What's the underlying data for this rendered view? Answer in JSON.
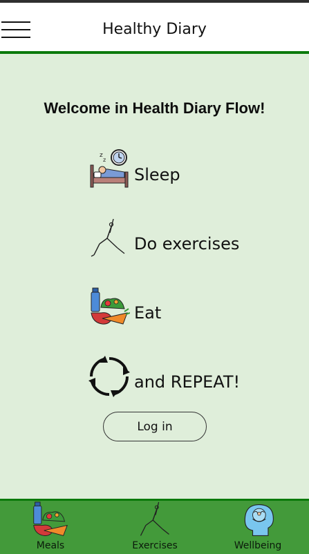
{
  "header": {
    "title": "Healthy Diary",
    "menu_icon": "hamburger-menu-icon"
  },
  "main": {
    "welcome": "Welcome in Health Diary Flow!",
    "flow": [
      {
        "label": "Sleep",
        "icon": "sleeping-bed-clock-icon"
      },
      {
        "label": "Do exercises",
        "icon": "yoga-pose-icon"
      },
      {
        "label": "Eat",
        "icon": "healthy-food-icon"
      },
      {
        "label": "and REPEAT!",
        "icon": "repeat-cycle-icon"
      }
    ],
    "login_label": "Log in"
  },
  "bottom_nav": {
    "items": [
      {
        "label": "Meals",
        "icon": "healthy-food-icon"
      },
      {
        "label": "Exercises",
        "icon": "yoga-pose-icon"
      },
      {
        "label": "Wellbeing",
        "icon": "wellbeing-head-icon"
      }
    ]
  },
  "colors": {
    "header_rule": "#0b7a0b",
    "main_background": "#dfeeda",
    "bottom_nav_background": "#439a3a"
  }
}
